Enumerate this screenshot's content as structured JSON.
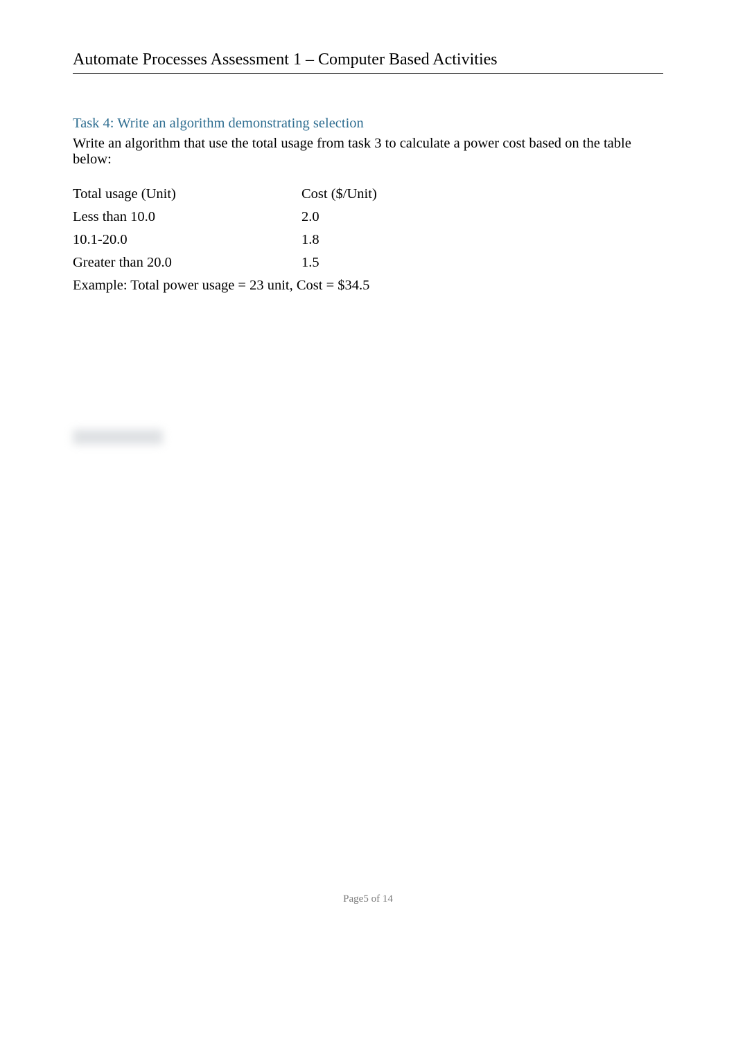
{
  "header": {
    "title": "Automate Processes Assessment 1 – Computer Based Activities"
  },
  "task": {
    "heading": "Task 4: Write an algorithm demonstrating selection",
    "description": "Write an algorithm that use the total usage from task 3 to calculate a power cost based on the table below:"
  },
  "table": {
    "header": {
      "col_a": "Total usage (Unit)",
      "col_b": "Cost ($/Unit)"
    },
    "rows": [
      {
        "col_a": "Less than 10.0",
        "col_b": "2.0"
      },
      {
        "col_a": "10.1-20.0",
        "col_b": "1.8"
      },
      {
        "col_a": "Greater than 20.0",
        "col_b": "1.5"
      }
    ]
  },
  "example": "Example: Total power usage = 23 unit, Cost = $34.5",
  "footer": {
    "label": "Page",
    "current": "5",
    "sep": "of",
    "total": "14"
  }
}
